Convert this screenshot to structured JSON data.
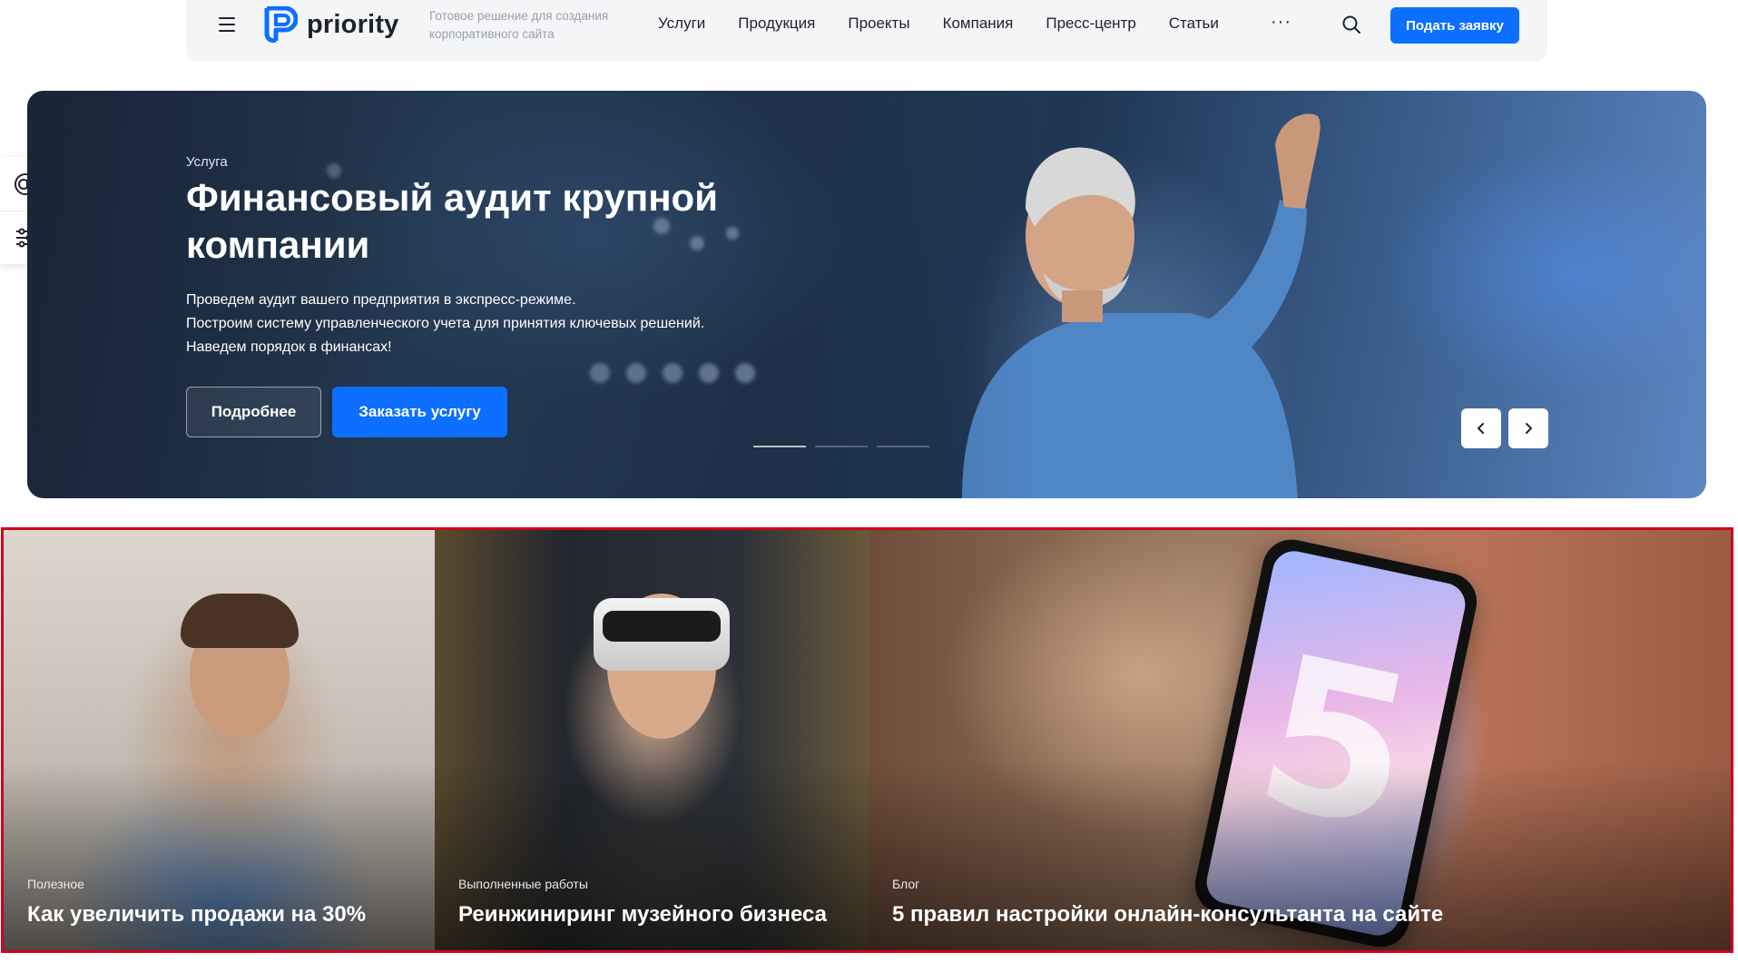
{
  "header": {
    "brand": "priority",
    "tagline": "Готовое решение для создания корпоративного сайта",
    "nav": [
      "Услуги",
      "Продукция",
      "Проекты",
      "Компания",
      "Пресс-центр",
      "Статьи"
    ],
    "more": "···",
    "cta": "Подать заявку"
  },
  "hero": {
    "label": "Услуга",
    "title": "Финансовый аудит крупной компании",
    "text": [
      "Проведем аудит вашего предприятия в экспресс-режиме.",
      "Построим систему управленческого учета для принятия ключевых решений.",
      "Наведем порядок в финансах!"
    ],
    "btn_more": "Подробнее",
    "btn_order": "Заказать услугу"
  },
  "cards": [
    {
      "tag": "Полезное",
      "title": "Как увеличить продажи на 30%"
    },
    {
      "tag": "Выполненные работы",
      "title": "Реинжиниринг музейного бизнеса"
    },
    {
      "tag": "Блог",
      "title": "5 правил настройки онлайн-консультанта на сайте"
    }
  ],
  "colors": {
    "accent": "#0c6fff",
    "highlight_border": "#d0021b"
  },
  "icons": {
    "menu": "hamburger-icon",
    "search": "search-icon",
    "side_top": "accessibility-icon",
    "side_bottom": "sliders-icon",
    "prev": "chevron-left-icon",
    "next": "chevron-right-icon"
  }
}
